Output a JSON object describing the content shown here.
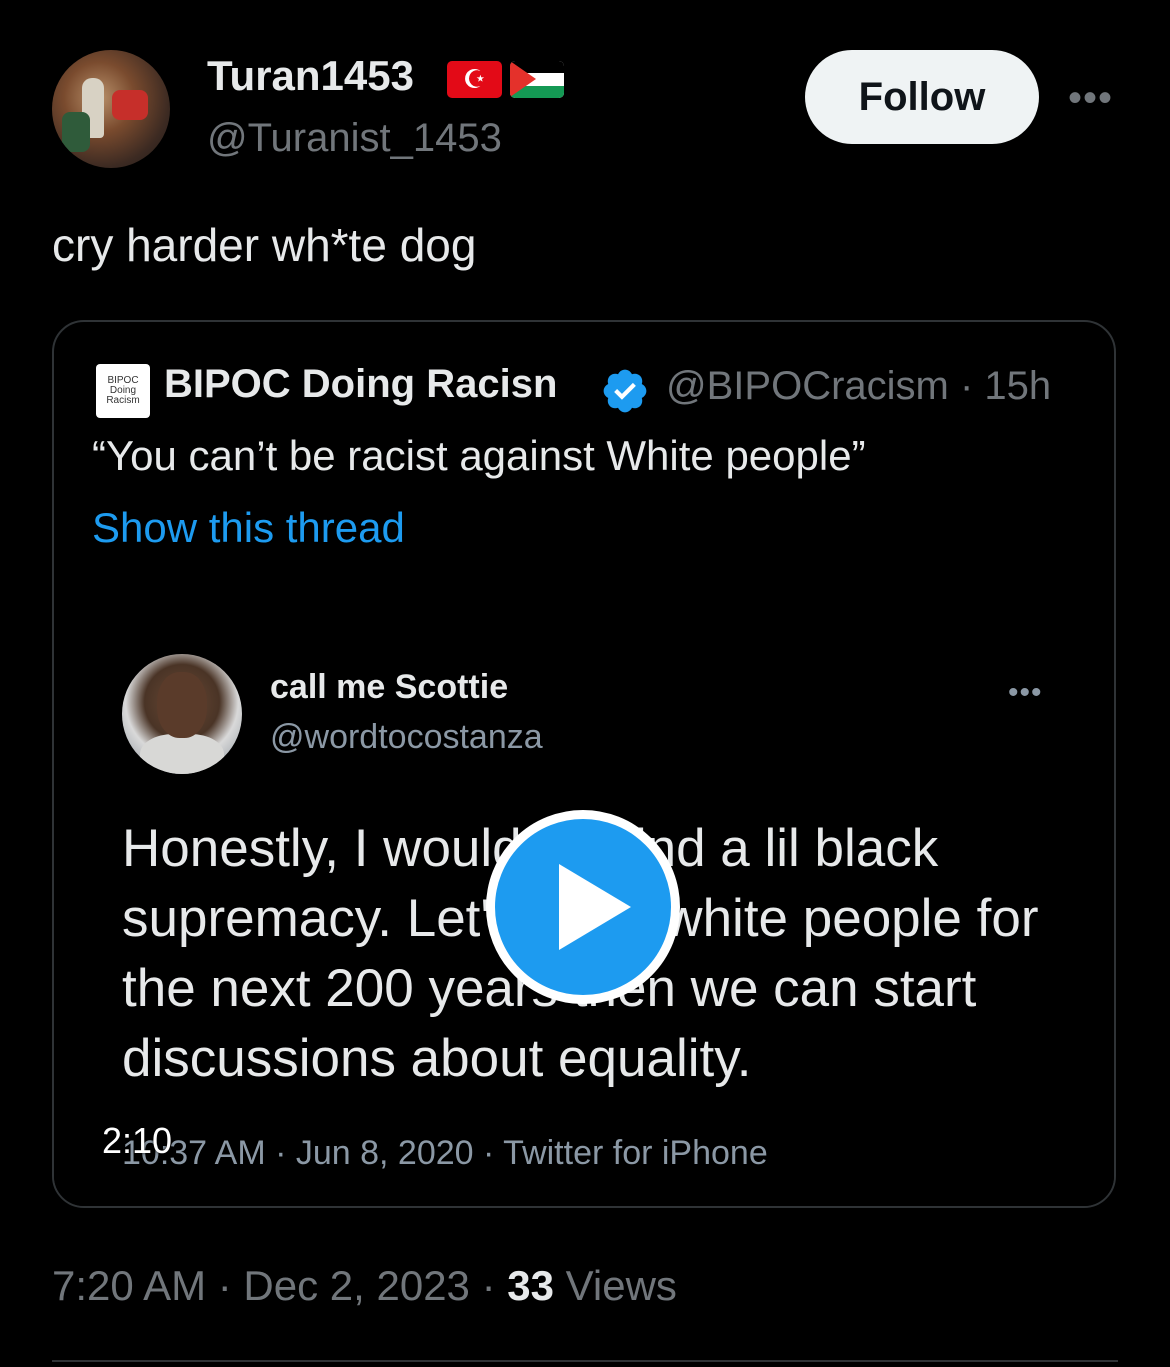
{
  "tweet": {
    "author_name": "Turan1453",
    "author_handle": "@Turanist_1453",
    "flags": [
      "turkey-flag",
      "palestine-flag"
    ],
    "follow_label": "Follow",
    "more_label": "•••",
    "text": "cry harder wh*te dog",
    "timestamp": "7:20 AM · Dec 2, 2023 · ",
    "views_count": "33",
    "views_label": " Views"
  },
  "quote": {
    "avatar_text": [
      "BIPOC",
      "Doing",
      "Racism"
    ],
    "author_name": "BIPOC Doing Racisn",
    "author_handle": "@BIPOCracism · 15h",
    "text": "“You can’t be racist against White people”",
    "link": "Show this thread",
    "media": {
      "duration": "2:10",
      "inner_tweet": {
        "author_name": "call me Scottie",
        "author_handle": "@wordtocostanza",
        "more_label": "•••",
        "text": "Honestly, I wouldn't mind a lil black supremacy. Let's torch white people for the next 200 years then we can start discussions about equality.",
        "meta": "10:37 AM · Jun 8, 2020 · Twitter for iPhone"
      }
    }
  },
  "colors": {
    "background": "#000000",
    "link": "#1d9bf0",
    "secondary_text": "#71767b",
    "verified": "#1d9bf0"
  }
}
